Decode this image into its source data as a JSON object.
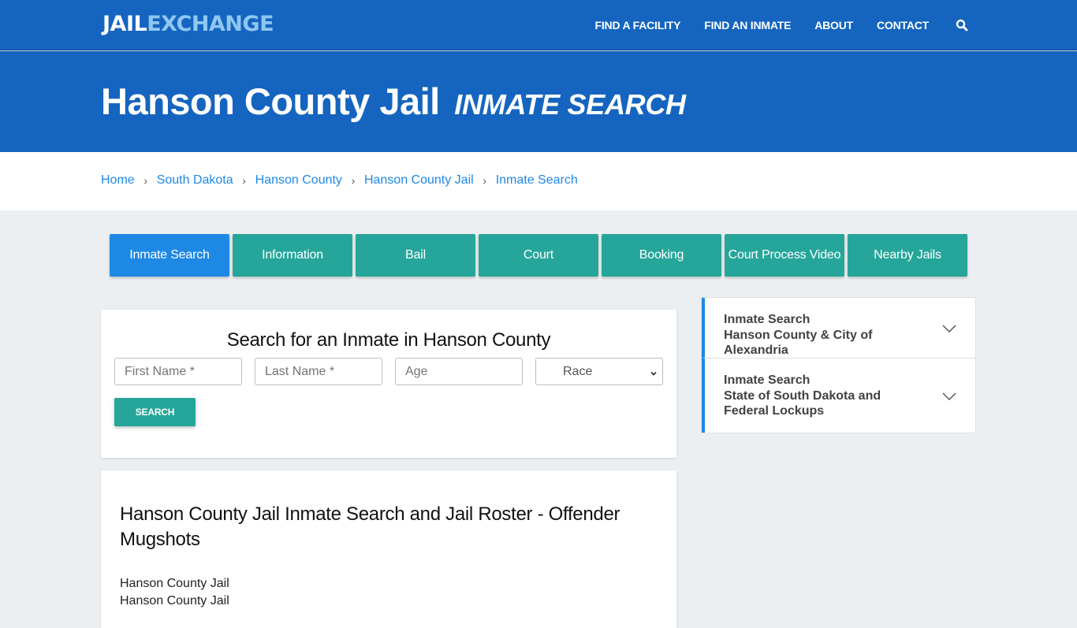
{
  "brand": {
    "part1": "JAIL",
    "part2": "EXCHANGE"
  },
  "nav": {
    "links": [
      "FIND A FACILITY",
      "FIND AN INMATE",
      "ABOUT",
      "CONTACT"
    ],
    "search_icon": "search-icon"
  },
  "hero": {
    "title": "Hanson County Jail",
    "subtitle": "INMATE SEARCH"
  },
  "breadcrumb": [
    "Home",
    "South Dakota",
    "Hanson County",
    "Hanson County Jail",
    "Inmate Search"
  ],
  "tabs": [
    {
      "label": "Inmate Search",
      "active": true
    },
    {
      "label": "Information",
      "active": false
    },
    {
      "label": "Bail",
      "active": false
    },
    {
      "label": "Court",
      "active": false
    },
    {
      "label": "Booking",
      "active": false
    },
    {
      "label": "Court Process Video",
      "active": false
    },
    {
      "label": "Nearby Jails",
      "active": false
    }
  ],
  "search_form": {
    "title": "Search for an Inmate in Hanson County",
    "first_name_placeholder": "First Name *",
    "last_name_placeholder": "Last Name *",
    "age_placeholder": "Age",
    "race_selected": "Race",
    "button": "SEARCH"
  },
  "info": {
    "heading": "Hanson County Jail Inmate Search and Jail Roster - Offender Mugshots",
    "lines": [
      "Hanson County Jail",
      "Hanson County Jail"
    ]
  },
  "sidebar": {
    "items": [
      {
        "line1": "Inmate Search",
        "line2": "Hanson County & City of Alexandria"
      },
      {
        "line1": "Inmate Search",
        "line2": "State of South Dakota and Federal Lockups"
      }
    ]
  },
  "colors": {
    "primary": "#1565c0",
    "accent": "#1e88e5",
    "teal": "#26a69a",
    "logo_light": "#8fc7f3"
  }
}
